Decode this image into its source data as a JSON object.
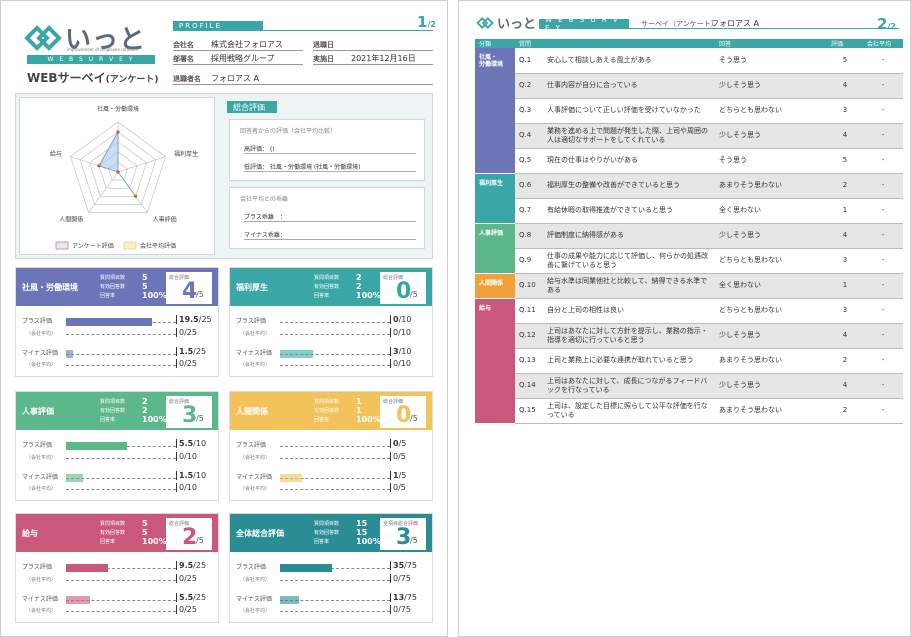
{
  "p1": {
    "logo_text": "いっと",
    "logo_tagline": "improvement of employee relations",
    "web_survey": "W E B   S U R V E Y",
    "title": "WEBサーベイ",
    "title_suffix": "(アンケート)",
    "profile_tag": "PROFILE",
    "page_num": "1",
    "page_den": "/2",
    "fields": [
      {
        "label": "会社名",
        "value": "株式会社フォロアス"
      },
      {
        "label": "部署名",
        "value": "採用戦略グループ"
      },
      {
        "label": "退職者名",
        "value": "フォロアス A"
      }
    ],
    "right_fields": [
      {
        "label": "退職日",
        "value": ""
      },
      {
        "label": "実施日",
        "value": "2021年12月16日"
      }
    ],
    "radar": {
      "labels": [
        "社風・労働環境",
        "福利厚生",
        "人事評価",
        "人間関係",
        "給与"
      ],
      "values": [
        4,
        0,
        3,
        0,
        2
      ],
      "company_avg": [
        0,
        0,
        0,
        0,
        0
      ],
      "max": 5,
      "legend": [
        "アンケート評価",
        "会社平均評価"
      ],
      "colors": [
        "#a8c6ea",
        "#d95b2a"
      ]
    },
    "overall": {
      "tag": "総合評価",
      "box1_title": "回答者からの評価（会社平均比較）",
      "high_label": "高評価：",
      "high_value": "()",
      "low_label": "低評価：",
      "low_value": "社風・労働環境 (社風・労働環境)",
      "box2_title": "会社平均との乖離",
      "plus_label": "プラス乖離　：",
      "minus_label": "マイナス乖離："
    },
    "stat_labels": [
      "質問項目数",
      "有効回答数",
      "回答率"
    ],
    "score_title": "総合評価",
    "plus_label": "プラス評価",
    "minus_label": "マイナス評価",
    "avg_label": "（会社平均）",
    "cards": [
      {
        "name": "社風・労働環境",
        "color": "#6c75b8",
        "stats": [
          "5",
          "5",
          "100%"
        ],
        "score": "4",
        "den": "/5",
        "plus": "19.5",
        "plus_den": "/25",
        "plus_avg": "0/25",
        "minus": "1.5",
        "minus_den": "/25",
        "minus_avg": "0/25",
        "plus_ratio": 0.78,
        "minus_ratio": 0.06
      },
      {
        "name": "福利厚生",
        "color": "#3aa6a6",
        "stats": [
          "2",
          "2",
          "100%"
        ],
        "score": "0",
        "den": "/5",
        "plus": "0",
        "plus_den": "/10",
        "plus_avg": "0/10",
        "minus": "3",
        "minus_den": "/10",
        "minus_avg": "0/10",
        "plus_ratio": 0,
        "minus_ratio": 0.3
      },
      {
        "name": "人事評価",
        "color": "#5cb78a",
        "stats": [
          "2",
          "2",
          "100%"
        ],
        "score": "3",
        "den": "/5",
        "plus": "5.5",
        "plus_den": "/10",
        "plus_avg": "0/10",
        "minus": "1.5",
        "minus_den": "/10",
        "minus_avg": "0/10",
        "plus_ratio": 0.55,
        "minus_ratio": 0.15
      },
      {
        "name": "人間関係",
        "color": "#f2c25b",
        "stats": [
          "1",
          "1",
          "100%"
        ],
        "score": "0",
        "den": "/5",
        "plus": "0",
        "plus_den": "/5",
        "plus_avg": "0/5",
        "minus": "1",
        "minus_den": "/5",
        "minus_avg": "0/5",
        "plus_ratio": 0,
        "minus_ratio": 0.2
      },
      {
        "name": "給与",
        "color": "#c9587a",
        "stats": [
          "5",
          "5",
          "100%"
        ],
        "score": "2",
        "den": "/5",
        "plus": "9.5",
        "plus_den": "/25",
        "plus_avg": "0/25",
        "minus": "5.5",
        "minus_den": "/25",
        "minus_avg": "0/25",
        "plus_ratio": 0.38,
        "minus_ratio": 0.22
      },
      {
        "name": "全体総合評価",
        "color": "#2a8c94",
        "stats": [
          "15",
          "15",
          "100%"
        ],
        "score": "3",
        "den": "/5",
        "plus": "35",
        "plus_den": "/75",
        "plus_avg": "0/75",
        "minus": "13",
        "minus_den": "/75",
        "minus_avg": "0/75",
        "plus_ratio": 0.47,
        "minus_ratio": 0.17,
        "score_title": "全項目総合評価"
      }
    ]
  },
  "p2": {
    "logo_text": "いっと",
    "web_survey": "W E B   S U R V E Y",
    "subtitle": "サーベイ（アンケート）",
    "name": "フォロアス A",
    "page_num": "2",
    "page_den": "/2",
    "headers": [
      "分類",
      "質問",
      "",
      "回答",
      "評価",
      "会社平均"
    ],
    "categories": [
      {
        "name": "社風・\n労働環境",
        "color": "#6c75b8",
        "rows": 5
      },
      {
        "name": "福利厚生",
        "color": "#3aa6a6",
        "rows": 2
      },
      {
        "name": "人事評価",
        "color": "#5cb78a",
        "rows": 2
      },
      {
        "name": "人間関係",
        "color": "#f2a03b",
        "rows": 1
      },
      {
        "name": "給与",
        "color": "#c9587a",
        "rows": 5
      }
    ],
    "rows": [
      {
        "q": "Q.1",
        "text": "安心して相談しあえる風土がある",
        "ans": "そう思う",
        "score": "5",
        "avg": "-"
      },
      {
        "q": "Q.2",
        "text": "仕事内容が自分に合っている",
        "ans": "少しそう思う",
        "score": "4",
        "avg": "-"
      },
      {
        "q": "Q.3",
        "text": "人事評価について正しい評価を受けていなかった",
        "ans": "どちらとも思わない",
        "score": "3",
        "avg": "-"
      },
      {
        "q": "Q.4",
        "text": "業務を進める上で問題が発生した際、上司や周囲の人は適切なサポートをしてくれている",
        "ans": "少しそう思う",
        "score": "4",
        "avg": "-"
      },
      {
        "q": "Q.5",
        "text": "現在の仕事はやりがいがある",
        "ans": "そう思う",
        "score": "5",
        "avg": "-"
      },
      {
        "q": "Q.6",
        "text": "福利厚生の整備や改善ができていると思う",
        "ans": "あまりそう思わない",
        "score": "2",
        "avg": "-"
      },
      {
        "q": "Q.7",
        "text": "有給休暇の取得推進ができていると思う",
        "ans": "全く思わない",
        "score": "1",
        "avg": "-"
      },
      {
        "q": "Q.8",
        "text": "評価制度に納得感がある",
        "ans": "少しそう思う",
        "score": "4",
        "avg": "-"
      },
      {
        "q": "Q.9",
        "text": "仕事の成果や能力に応じて評価し、何らかの処遇改善に繋げていると思う",
        "ans": "どちらとも思わない",
        "score": "3",
        "avg": "-"
      },
      {
        "q": "Q.10",
        "text": "給与水準は同業他社と比較して、納得できる水準である",
        "ans": "全く思わない",
        "score": "1",
        "avg": "-"
      },
      {
        "q": "Q.11",
        "text": "自分と上司の相性は良い",
        "ans": "どちらとも思わない",
        "score": "3",
        "avg": "-"
      },
      {
        "q": "Q.12",
        "text": "上司はあなたに対して方針を提示し、業務の指示・指導を適切に行っていると思う",
        "ans": "少しそう思う",
        "score": "4",
        "avg": "-"
      },
      {
        "q": "Q.13",
        "text": "上司と業務上に必要な連携が取れていると思う",
        "ans": "あまりそう思わない",
        "score": "2",
        "avg": "-"
      },
      {
        "q": "Q.14",
        "text": "上司はあなたに対して、成長につながるフィードバックを行なっている",
        "ans": "少しそう思う",
        "score": "4",
        "avg": "-"
      },
      {
        "q": "Q.15",
        "text": "上司は、設定した目標に照らして公平な評価を行なっている",
        "ans": "あまりそう思わない",
        "score": "2",
        "avg": "-"
      }
    ]
  }
}
